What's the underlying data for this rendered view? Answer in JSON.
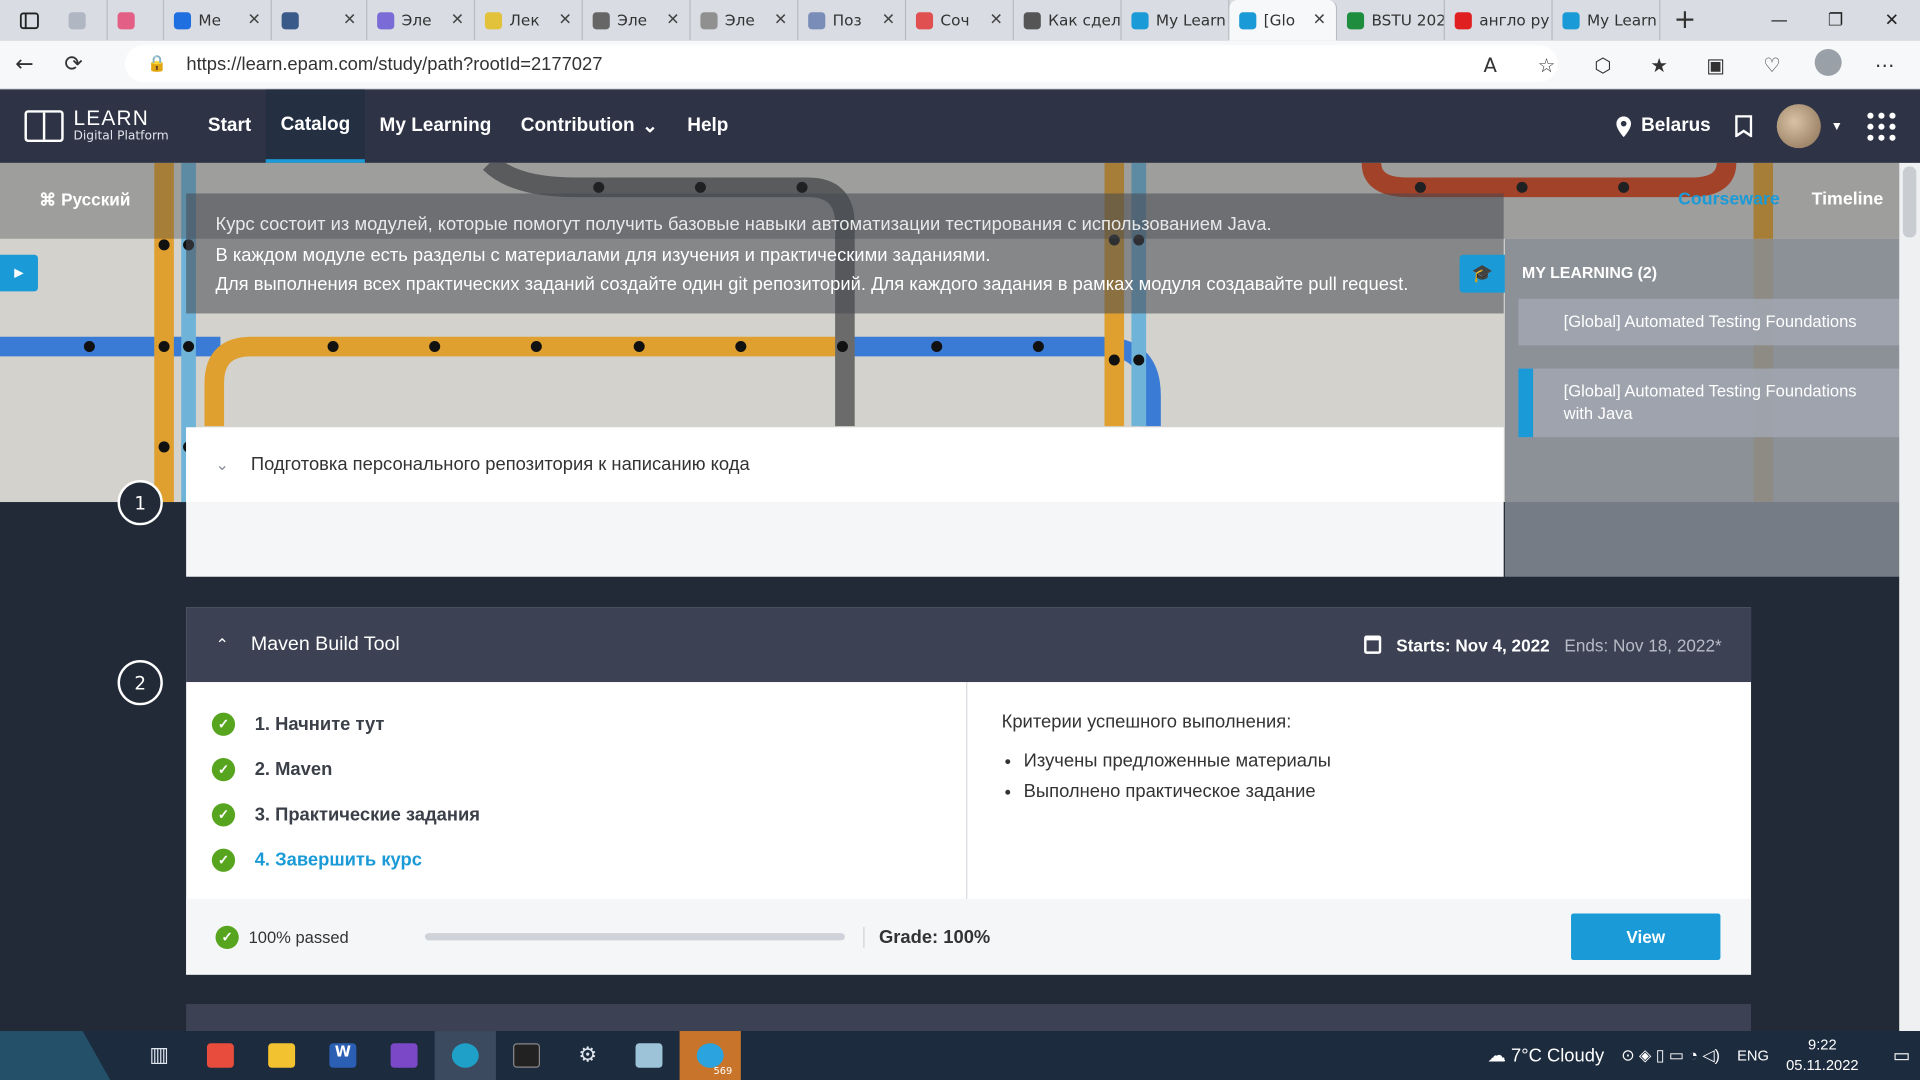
{
  "browser": {
    "tabs": [
      {
        "label": "",
        "color": "#b0b7c3",
        "active": false
      },
      {
        "label": "",
        "color": "#e45f86",
        "active": false
      },
      {
        "label": "Me",
        "color": "#1f6fe0",
        "active": false
      },
      {
        "label": "",
        "color": "#3a5a8a",
        "active": false
      },
      {
        "label": "Эле",
        "color": "#7b6bd6",
        "active": false
      },
      {
        "label": "Лек",
        "color": "#e2c23b",
        "active": false
      },
      {
        "label": "Эле",
        "color": "#666666",
        "active": false
      },
      {
        "label": "Эле",
        "color": "#909090",
        "active": false
      },
      {
        "label": "Поз",
        "color": "#7a8cb8",
        "active": false
      },
      {
        "label": "Соч",
        "color": "#e05050",
        "active": false
      },
      {
        "label": "Как сдел",
        "color": "#555555",
        "active": false
      },
      {
        "label": "My Learn",
        "color": "#1a9ad6",
        "active": false
      },
      {
        "label": "[Glo",
        "color": "#1a9ad6",
        "active": true
      },
      {
        "label": "BSTU 202",
        "color": "#1e8e3e",
        "active": false
      },
      {
        "label": "англо ру",
        "color": "#e02020",
        "active": false
      },
      {
        "label": "My Learn",
        "color": "#1a9ad6",
        "active": false
      }
    ],
    "url": "https://learn.epam.com/study/path?rootId=2177027"
  },
  "header": {
    "logo_title": "LEARN",
    "logo_subtitle": "Digital Platform",
    "nav": [
      {
        "label": "Start"
      },
      {
        "label": "Catalog",
        "current": true
      },
      {
        "label": "My Learning"
      },
      {
        "label": "Contribution",
        "dropdown": true
      },
      {
        "label": "Help"
      }
    ],
    "location": "Belarus"
  },
  "subbar": {
    "language": "Русский",
    "tabs": [
      "Courseware",
      "Timeline"
    ]
  },
  "description": [
    "Курс состоит из модулей, которые помогут получить базовые навыки автоматизации тестирования с использованием Java.",
    "В каждом модуле есть разделы с материалами для изучения и практическими заданиями.",
    "Для выполнения всех практических заданий создайте один git репозиторий. Для каждого задания в рамках модуля создавайте pull request."
  ],
  "my_learning": {
    "title": "MY LEARNING (2)",
    "items": [
      {
        "label": "[Global] Automated Testing Foundations",
        "selected": false
      },
      {
        "label": "[Global] Automated Testing Foundations with Java",
        "selected": true
      }
    ]
  },
  "modules": [
    {
      "number": "1",
      "title": "Подготовка персонального репозитория к написанию кода"
    },
    {
      "number": "2",
      "title": "Maven Build Tool",
      "starts": "Starts: Nov 4, 2022",
      "ends": "Ends: Nov 18, 2022*",
      "lessons": [
        "1. Начните тут",
        "2. Maven",
        "3. Практические задания",
        "4. Завершить курс"
      ],
      "criteria_title": "Критерии успешного выполнения:",
      "criteria": [
        "Изучены предложенные материалы",
        "Выполнено практическое задание"
      ],
      "passed": "100% passed",
      "progress": 100,
      "grade": "Grade: 100%",
      "view_label": "View"
    }
  ],
  "taskbar": {
    "weather": "7°C Cloudy",
    "lang": "ENG",
    "time": "9:22",
    "date": "05.11.2022",
    "telegram_badge": "569"
  },
  "colors": {
    "accent": "#1a9ad6",
    "success": "#57a41f",
    "header": "#2e3445"
  }
}
